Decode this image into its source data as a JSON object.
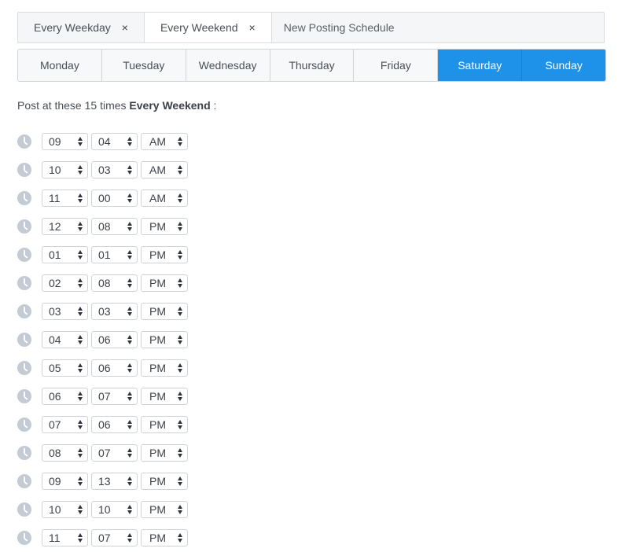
{
  "tabs": [
    {
      "label": "Every Weekday",
      "closable": true,
      "active": false
    },
    {
      "label": "Every Weekend",
      "closable": true,
      "active": true
    },
    {
      "label": "New Posting Schedule",
      "closable": false,
      "active": false
    }
  ],
  "close_glyph": "×",
  "days": [
    {
      "label": "Monday",
      "selected": false
    },
    {
      "label": "Tuesday",
      "selected": false
    },
    {
      "label": "Wednesday",
      "selected": false
    },
    {
      "label": "Thursday",
      "selected": false
    },
    {
      "label": "Friday",
      "selected": false
    },
    {
      "label": "Saturday",
      "selected": true
    },
    {
      "label": "Sunday",
      "selected": true
    }
  ],
  "caption": {
    "prefix": "Post at these 15 times ",
    "schedule_name": "Every Weekend",
    "suffix": " :"
  },
  "times": [
    {
      "hour": "09",
      "minute": "04",
      "ampm": "AM"
    },
    {
      "hour": "10",
      "minute": "03",
      "ampm": "AM"
    },
    {
      "hour": "11",
      "minute": "00",
      "ampm": "AM"
    },
    {
      "hour": "12",
      "minute": "08",
      "ampm": "PM"
    },
    {
      "hour": "01",
      "minute": "01",
      "ampm": "PM"
    },
    {
      "hour": "02",
      "minute": "08",
      "ampm": "PM"
    },
    {
      "hour": "03",
      "minute": "03",
      "ampm": "PM"
    },
    {
      "hour": "04",
      "minute": "06",
      "ampm": "PM"
    },
    {
      "hour": "05",
      "minute": "06",
      "ampm": "PM"
    },
    {
      "hour": "06",
      "minute": "07",
      "ampm": "PM"
    },
    {
      "hour": "07",
      "minute": "06",
      "ampm": "PM"
    },
    {
      "hour": "08",
      "minute": "07",
      "ampm": "PM"
    },
    {
      "hour": "09",
      "minute": "13",
      "ampm": "PM"
    },
    {
      "hour": "10",
      "minute": "10",
      "ampm": "PM"
    },
    {
      "hour": "11",
      "minute": "07",
      "ampm": "PM"
    }
  ],
  "colors": {
    "accent": "#1e91e9",
    "clock_icon": "#c4cbd4",
    "tab_bar_bg": "#f4f6f8"
  }
}
